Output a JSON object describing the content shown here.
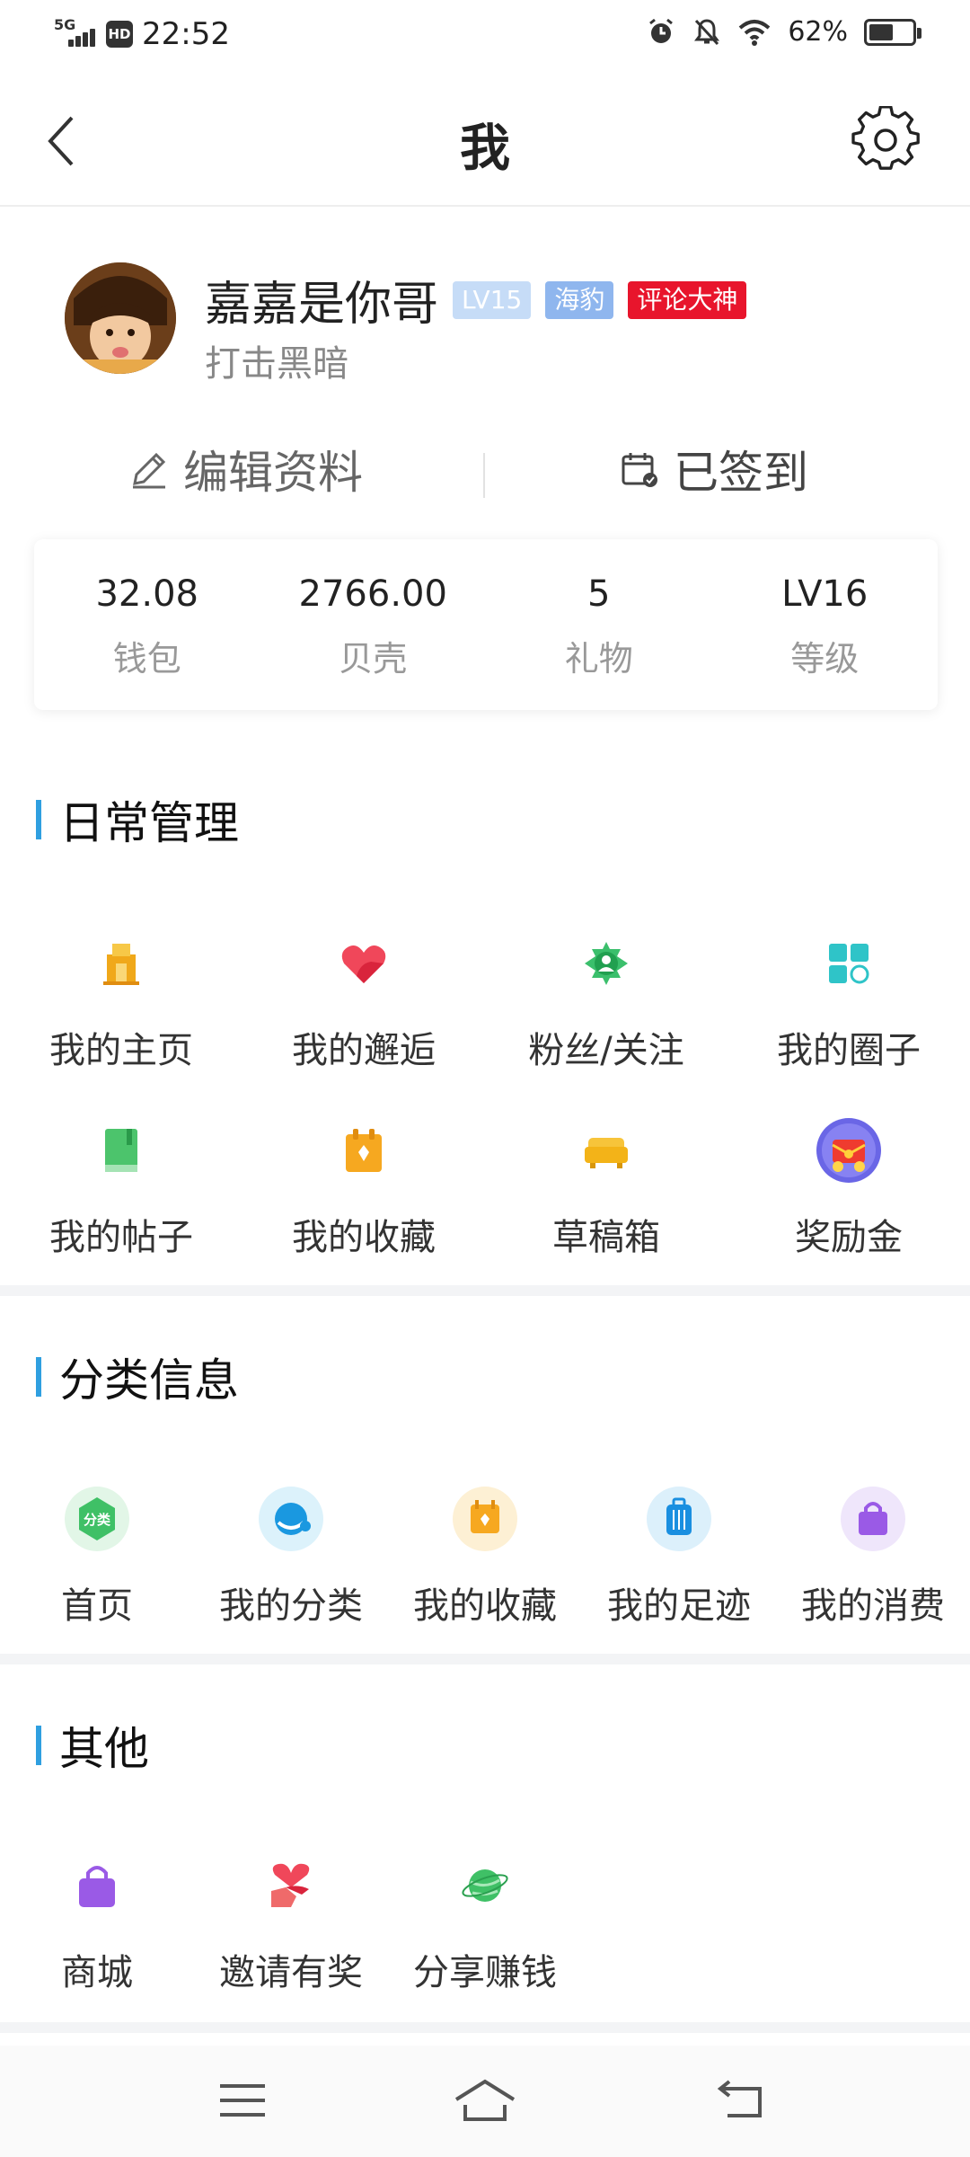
{
  "status_bar": {
    "network": "5G",
    "hd": "HD",
    "time": "22:52",
    "battery": "62%",
    "battery_level": 0.62
  },
  "header": {
    "title": "我"
  },
  "profile": {
    "username": "嘉嘉是你哥",
    "badges": [
      "LV15",
      "海豹",
      "评论大神"
    ],
    "signature": "打击黑暗"
  },
  "actions": {
    "edit_label": "编辑资料",
    "sign_label": "已签到"
  },
  "stats": [
    {
      "value": "32.08",
      "label": "钱包"
    },
    {
      "value": "2766.00",
      "label": "贝壳"
    },
    {
      "value": "5",
      "label": "礼物"
    },
    {
      "value": "LV16",
      "label": "等级"
    }
  ],
  "daily": {
    "title": "日常管理",
    "items": [
      {
        "label": "我的主页",
        "icon": "home-page-icon"
      },
      {
        "label": "我的邂逅",
        "icon": "heart-icon"
      },
      {
        "label": "粉丝/关注",
        "icon": "fans-icon"
      },
      {
        "label": "我的圈子",
        "icon": "circle-grid-icon"
      },
      {
        "label": "我的帖子",
        "icon": "book-icon"
      },
      {
        "label": "我的收藏",
        "icon": "favorite-icon"
      },
      {
        "label": "草稿箱",
        "icon": "sofa-icon"
      },
      {
        "label": "奖励金",
        "icon": "reward-icon"
      }
    ]
  },
  "category": {
    "title": "分类信息",
    "items": [
      {
        "label": "首页",
        "icon": "category-home-icon",
        "glyph": "分类"
      },
      {
        "label": "我的分类",
        "icon": "chat-icon"
      },
      {
        "label": "我的收藏",
        "icon": "calendar-favorite-icon"
      },
      {
        "label": "我的足迹",
        "icon": "luggage-icon"
      },
      {
        "label": "我的消费",
        "icon": "bag-icon"
      }
    ]
  },
  "other": {
    "title": "其他",
    "items": [
      {
        "label": "商城",
        "icon": "shop-icon"
      },
      {
        "label": "邀请有奖",
        "icon": "invite-icon"
      },
      {
        "label": "分享赚钱",
        "icon": "share-icon"
      }
    ]
  },
  "nav": {
    "items": [
      "menu-icon",
      "home-icon",
      "back-icon"
    ]
  }
}
